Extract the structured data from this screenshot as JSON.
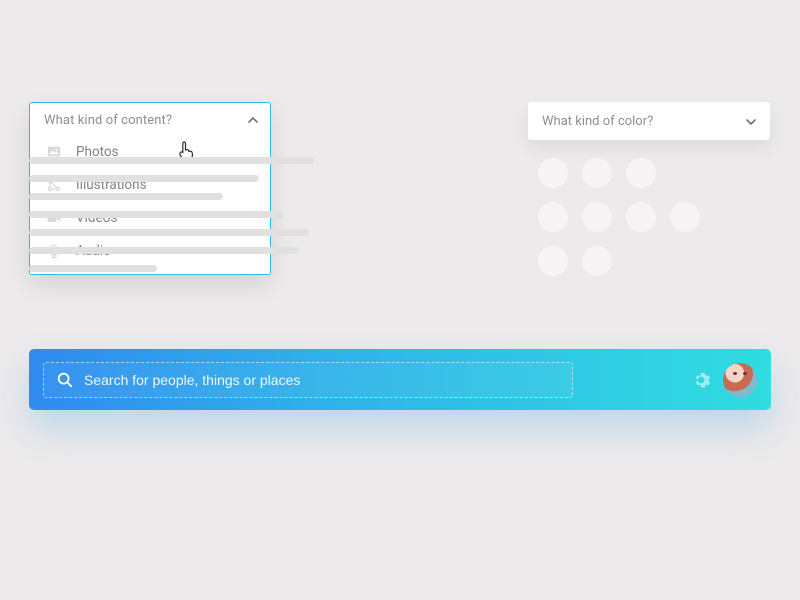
{
  "content_dropdown": {
    "header": "What kind of content?",
    "items": [
      {
        "icon": "image-icon",
        "label": "Photos"
      },
      {
        "icon": "vector-icon",
        "label": "Illustrations"
      },
      {
        "icon": "video-icon",
        "label": "Videos"
      },
      {
        "icon": "audio-icon",
        "label": "Audio"
      }
    ]
  },
  "color_dropdown": {
    "header": "What kind of color?"
  },
  "search": {
    "placeholder": "Search for people, things or places",
    "value": ""
  },
  "colors": {
    "accent": "#2fb8e6",
    "search_grad_start": "#2f8bf0",
    "search_grad_end": "#30dde0",
    "swatch": "#f5f3f4"
  }
}
